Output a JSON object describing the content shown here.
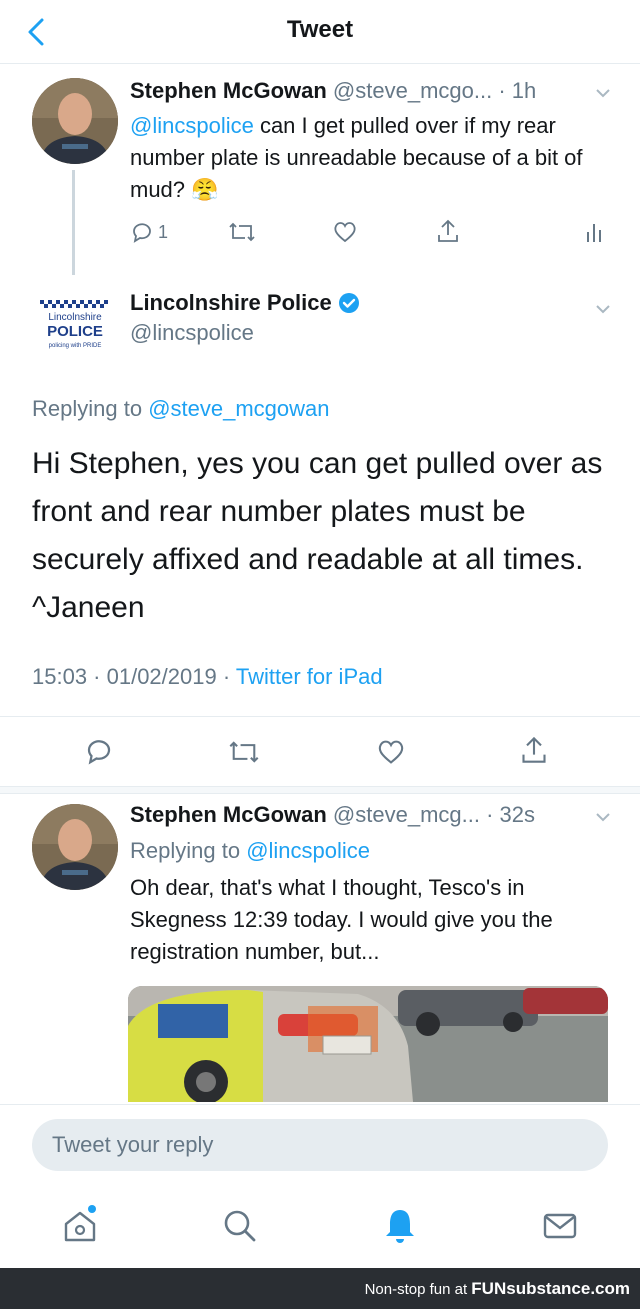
{
  "header": {
    "title": "Tweet"
  },
  "tweet1": {
    "author_name": "Stephen McGowan",
    "author_handle": "@steve_mcgo...",
    "time": "· 1h",
    "mention": "@lincspolice",
    "text": " can I get pulled over if my rear number plate is unreadable because of a bit of mud? 😤",
    "reply_count": "1"
  },
  "tweet2": {
    "author_name": "Lincolnshire Police",
    "author_handle": "@lincspolice",
    "logo_text": {
      "line1": "Lincolnshire",
      "line2": "POLICE",
      "line3": "policing with PRIDE"
    },
    "replying_prefix": "Replying to ",
    "replying_handle": "@steve_mcgowan",
    "text": "Hi Stephen, yes you can get pulled over as front and rear number plates must be securely affixed and readable at all times. ^Janeen",
    "timestamp": "15:03 · 01/02/2019 · ",
    "source": "Twitter for iPad"
  },
  "tweet3": {
    "author_name": "Stephen McGowan",
    "author_handle": "@steve_mcg...",
    "time": "· 32s",
    "replying_prefix": "Replying to ",
    "replying_handle": "@lincspolice",
    "text": "Oh dear, that's what I thought, Tesco's in Skegness 12:39 today. I would give you the registration number, but..."
  },
  "reply": {
    "placeholder": "Tweet your reply"
  },
  "footer": {
    "prefix": "Non-stop fun at ",
    "brand": "FUNsubstance.com"
  },
  "colors": {
    "accent": "#1da1f2",
    "text": "#14171a",
    "muted": "#657786",
    "border": "#e6ecf0"
  }
}
